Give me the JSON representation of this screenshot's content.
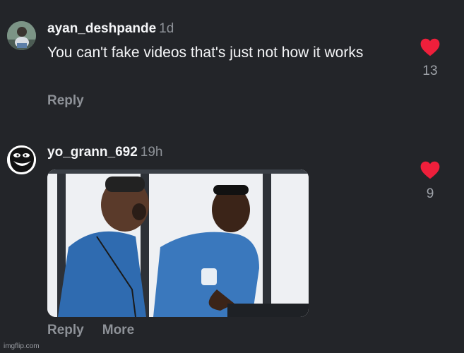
{
  "comments": [
    {
      "username": "ayan_deshpande",
      "time": "1d",
      "text": "You can't fake videos that's just not how it works",
      "likes": "13",
      "actions": {
        "reply": "Reply"
      }
    },
    {
      "username": "yo_grann_692",
      "time": "19h",
      "likes": "9",
      "actions": {
        "reply": "Reply",
        "more": "More"
      }
    }
  ],
  "colors": {
    "heart": "#ee1f3b",
    "background": "#232529"
  },
  "icons": [
    "heart-icon",
    "avatar-photo",
    "troll-face-avatar"
  ],
  "watermark": "imgflip.com"
}
